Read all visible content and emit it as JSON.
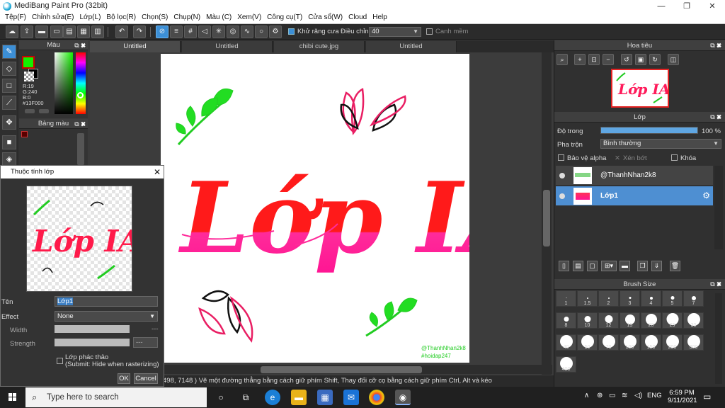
{
  "window": {
    "title": "MediBang Paint Pro (32bit)",
    "min": "—",
    "max": "❐",
    "close": "✕"
  },
  "menu": [
    "Tệp(F)",
    "Chỉnh sửa(E)",
    "Lớp(L)",
    "Bộ lọc(R)",
    "Chọn(S)",
    "Chụp(N)",
    "Màu (C)",
    "Xem(V)",
    "Công cụ(T)",
    "Cửa sổ(W)",
    "Cloud",
    "Help"
  ],
  "toolbar": {
    "antialias_label": "Khử răng cưa",
    "adjust_label": "Điều chỉnh",
    "adjust_value": "40",
    "smooth_label": "Canh mềm"
  },
  "color_panel": {
    "title": "Màu",
    "r": "R:19",
    "g": "G:240",
    "b": "B:0",
    "hex": "#13F000",
    "fg_color": "#13F000"
  },
  "palette_panel": {
    "title": "Bảng màu"
  },
  "tabs": [
    "Untitled",
    "Untitled",
    "chibi cute.jpg",
    "Untitled"
  ],
  "canvas": {
    "main_text": "Lớp IA",
    "credit_line1": "@ThanhNhan2k8",
    "credit_line2": "#hoidap247"
  },
  "status": {
    "coords": "498, 7148 )",
    "message": "Vẽ một đường thẳng bằng cách giữ phím Shift, Thay đổi cỡ cọ bằng cách giữ phím Ctrl, Alt và kéo"
  },
  "navigator": {
    "title": "Hoa tiêu"
  },
  "layer_panel": {
    "title": "Lớp",
    "opacity_label": "Độ trong",
    "opacity_value": "100 %",
    "opacity_fraction": 1.0,
    "blend_label": "Pha trộn",
    "blend_value": "Bình thường",
    "protect_alpha": "Bảo vệ alpha",
    "clipping": "Xén bớt",
    "lock": "Khóa",
    "layers": [
      {
        "name": "@ThanhNhan2k8",
        "selected": false
      },
      {
        "name": "Lớp1",
        "selected": true
      }
    ]
  },
  "brush_size": {
    "title": "Brush Size",
    "sizes": [
      "1",
      "1.5",
      "2",
      "3",
      "4",
      "5",
      "7",
      "8",
      "10",
      "12",
      "15",
      "20",
      "25",
      "30",
      "40",
      "50",
      "70",
      "100",
      "150",
      "200",
      "300",
      "400"
    ]
  },
  "dialog": {
    "title": "Thuộc tính lớp",
    "name_label": "Tên",
    "name_value": "Lớp1",
    "effect_label": "Effect",
    "effect_value": "None",
    "width_label": "Width",
    "width_value": "---",
    "strength_label": "Strength",
    "strength_value": "---",
    "draft_label": "Lớp phác thảo",
    "draft_sub": "(Submit: Hide when rasterizing)",
    "ok": "OK",
    "cancel": "Cancel"
  },
  "taskbar": {
    "search_placeholder": "Type here to search",
    "lang": "ENG",
    "time": "6:59 PM",
    "date": "9/11/2021"
  }
}
